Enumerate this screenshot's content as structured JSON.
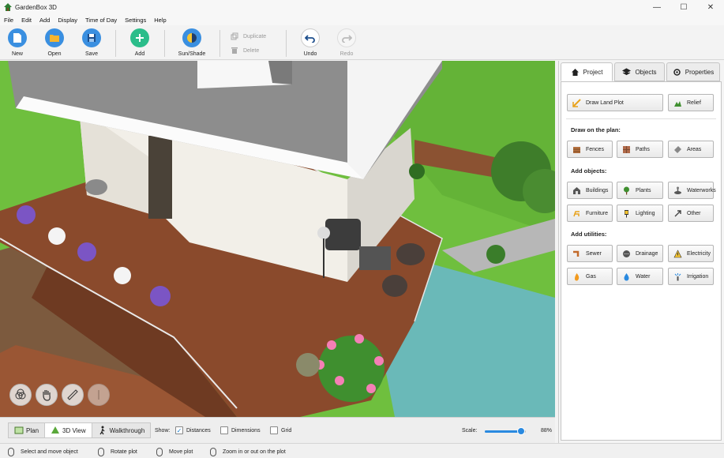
{
  "window": {
    "title": "GardenBox 3D",
    "controls": {
      "minimize": "—",
      "maximize": "☐",
      "close": "✕"
    }
  },
  "menu": [
    "File",
    "Edit",
    "Add",
    "Display",
    "Time of Day",
    "Settings",
    "Help"
  ],
  "toolbar": {
    "new_label": "New",
    "open_label": "Open",
    "save_label": "Save",
    "add_label": "Add",
    "sunshade_label": "Sun/Shade",
    "duplicate_label": "Duplicate",
    "delete_label": "Delete",
    "undo_label": "Undo",
    "redo_label": "Redo"
  },
  "view_tabs": {
    "plan": "Plan",
    "view3d": "3D View",
    "walkthrough": "Walkthrough",
    "active": "3D View"
  },
  "show": {
    "label": "Show:",
    "distances": "Distances",
    "dimensions": "Dimensions",
    "grid": "Grid",
    "distances_checked": true,
    "dimensions_checked": false,
    "grid_checked": false
  },
  "scale": {
    "label": "Scale:",
    "value_text": "88%",
    "value": 0.88
  },
  "status": {
    "select": "Select and move object",
    "rotate": "Rotate plot",
    "move": "Move plot",
    "zoom": "Zoom in or out on the plot"
  },
  "panel": {
    "tabs": {
      "project": "Project",
      "objects": "Objects",
      "properties": "Properties",
      "active": "Project"
    },
    "draw_land_plot": "Draw Land Plot",
    "relief": "Relief",
    "draw_on_plan": "Draw on the plan:",
    "fences": "Fences",
    "paths": "Paths",
    "areas": "Areas",
    "add_objects": "Add objects:",
    "buildings": "Buildings",
    "plants": "Plants",
    "waterworks": "Waterworks",
    "furniture": "Furniture",
    "lighting": "Lighting",
    "other": "Other",
    "add_utilities": "Add utilities:",
    "sewer": "Sewer",
    "drainage": "Drainage",
    "electricity": "Electricity",
    "gas": "Gas",
    "water": "Water",
    "irrigation": "Irrigation"
  },
  "colors": {
    "accent_blue": "#2a8ae0",
    "add_green": "#2bbd8a",
    "grass": "#6fbf3e",
    "deck_wood": "#8a4a2c",
    "pool_water": "#6ab9b8"
  }
}
